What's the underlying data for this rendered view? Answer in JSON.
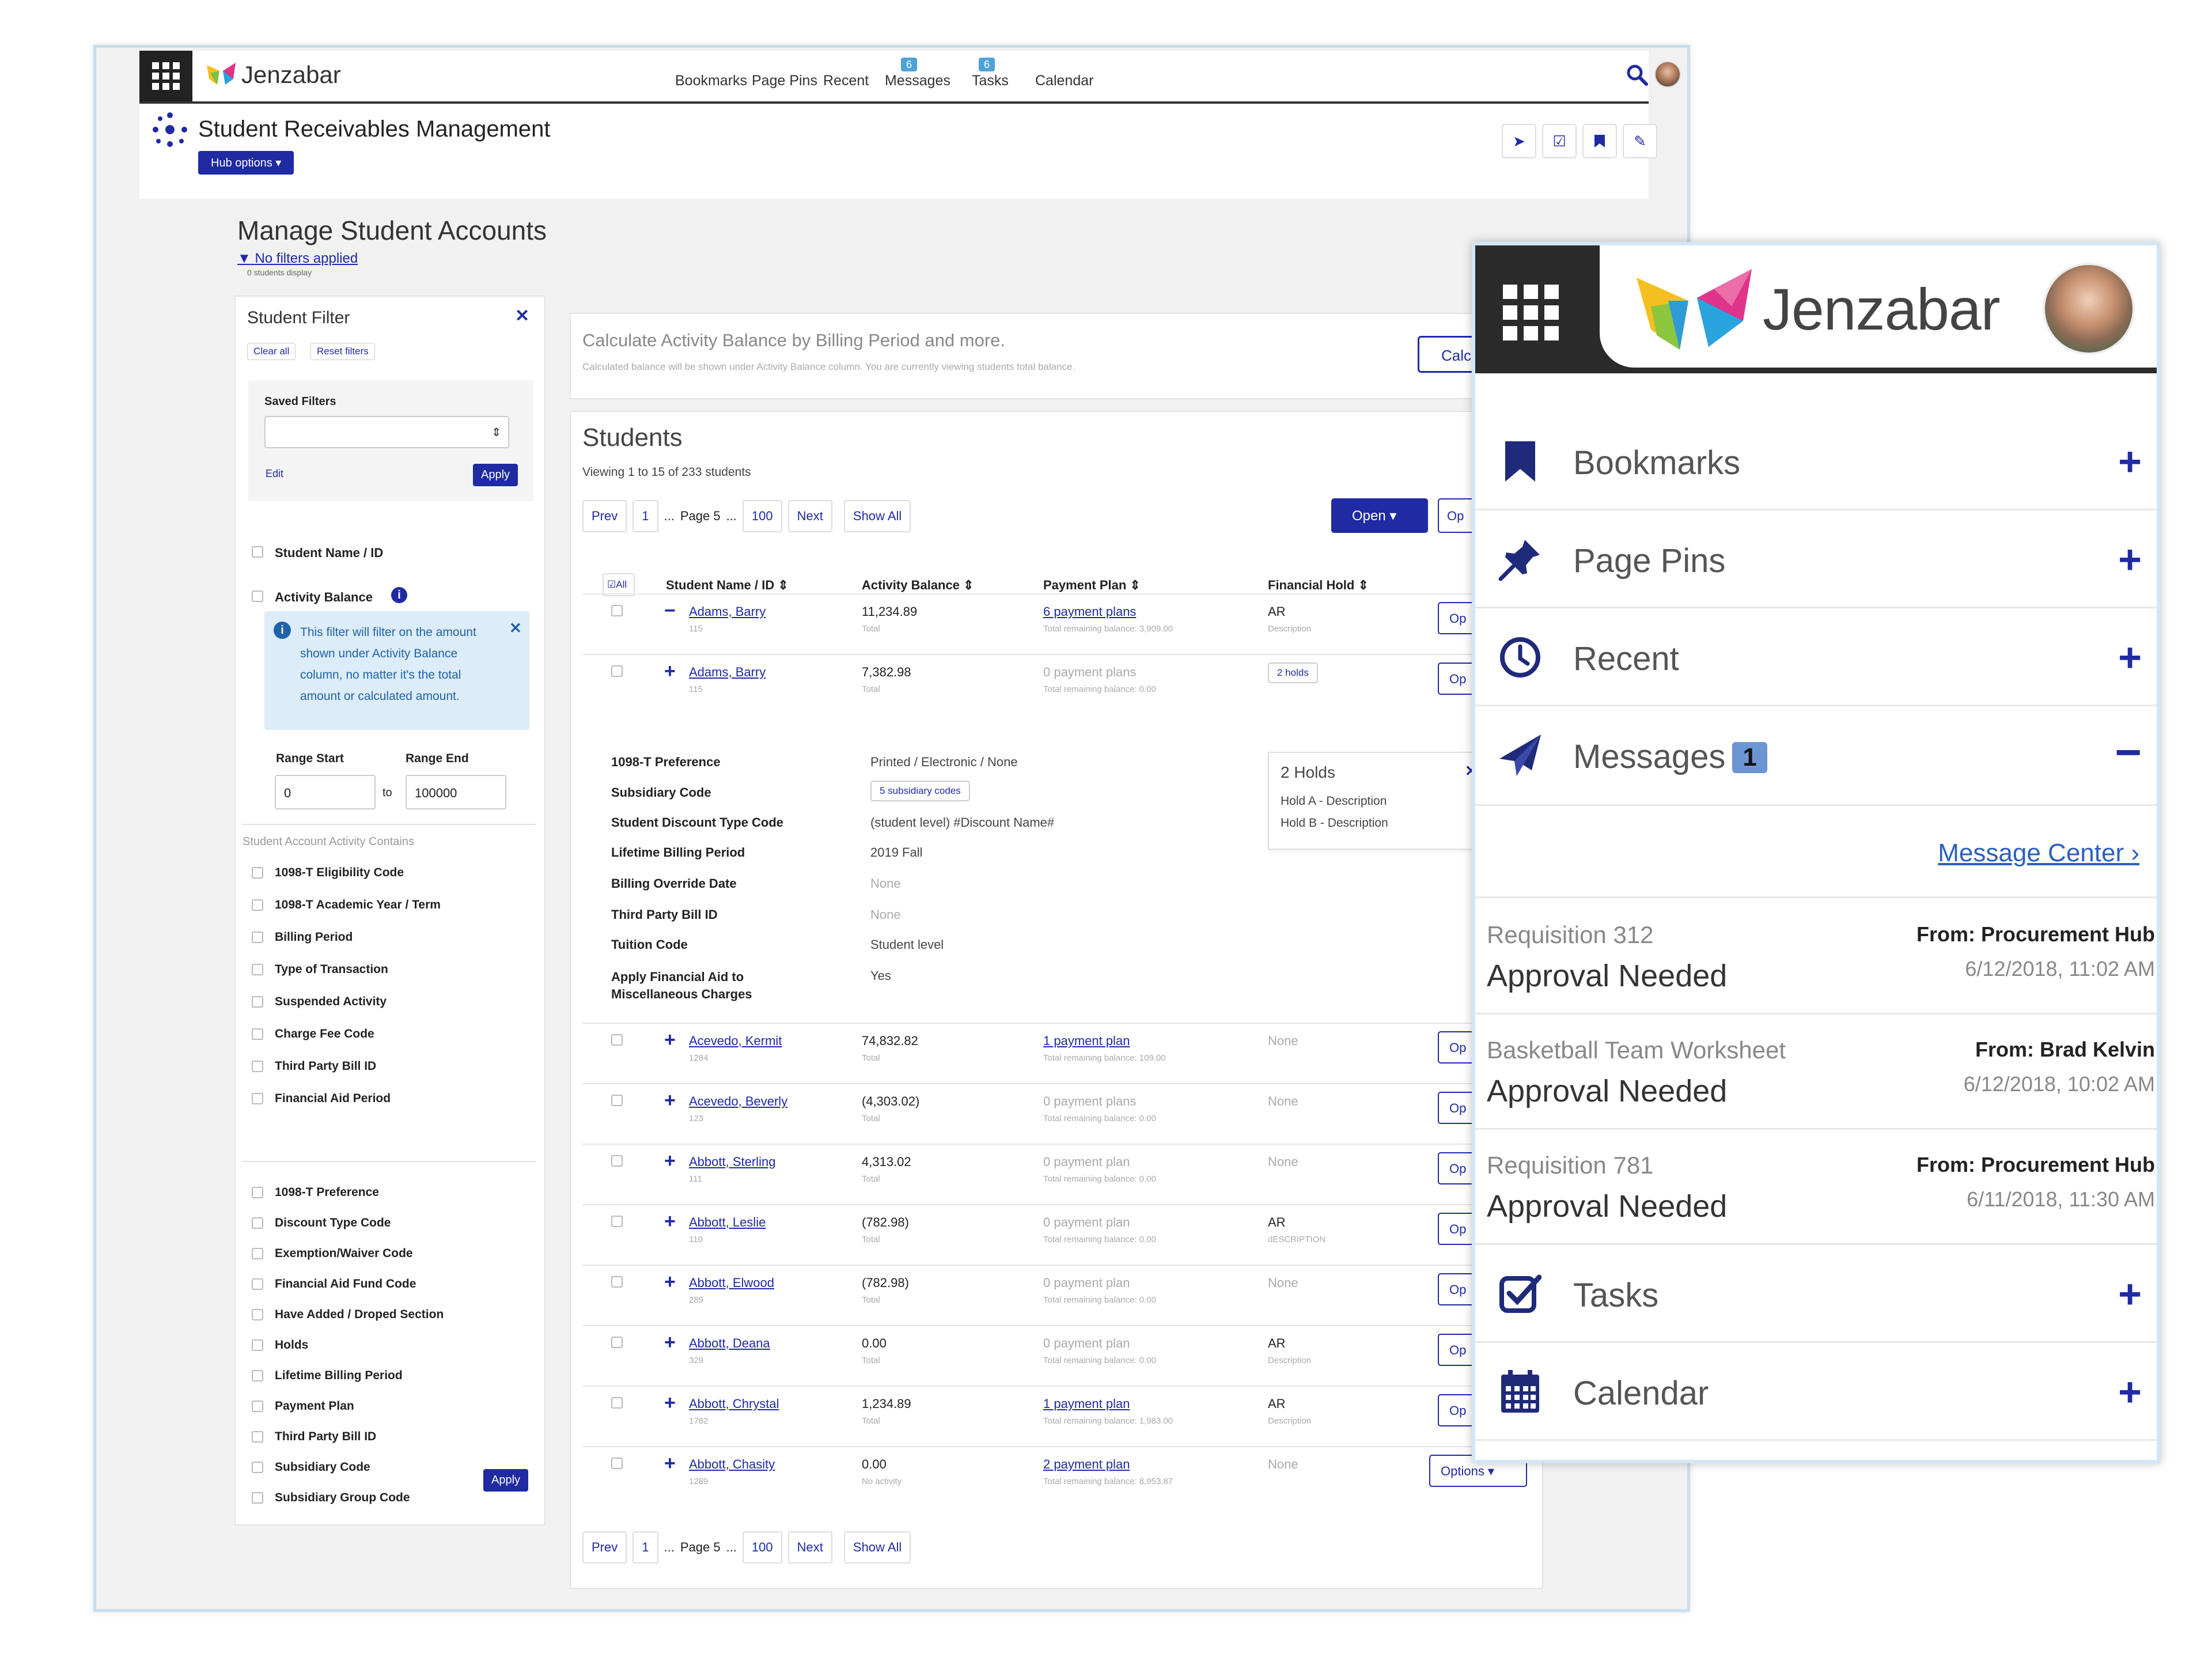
{
  "topbar": {
    "logo": "Jenzabar",
    "nav": [
      {
        "label": "Bookmarks",
        "badge": ""
      },
      {
        "label": "Page Pins",
        "badge": ""
      },
      {
        "label": "Recent",
        "badge": ""
      },
      {
        "label": "Messages",
        "badge": "6"
      },
      {
        "label": "Tasks",
        "badge": "6"
      },
      {
        "label": "Calendar",
        "badge": ""
      }
    ]
  },
  "hub": {
    "title": "Student Receivables Management",
    "options_label": "Hub options ▾"
  },
  "page": {
    "title": "Manage Student Accounts",
    "filters_link": "No filters applied",
    "count_text": "0 students display"
  },
  "filter": {
    "title": "Student Filter",
    "clear_all": "Clear all",
    "reset": "Reset filters",
    "saved_label": "Saved Filters",
    "edit": "Edit",
    "apply": "Apply",
    "name_id": "Student Name / ID",
    "activity_balance": "Activity Balance",
    "info": "This filter will filter on the amount shown under Activity Balance column, no matter it's the total amount or calculated amount.",
    "range_start_label": "Range Start",
    "range_end_label": "Range End",
    "range_start": "0",
    "range_to": "to",
    "range_end": "100000",
    "activity_header": "Student Account Activity Contains",
    "group1": [
      "1098-T Eligibility Code",
      "1098-T Academic Year / Term",
      "Billing Period",
      "Type of Transaction",
      "Suspended Activity",
      "Charge Fee Code",
      "Third Party Bill ID",
      "Financial Aid Period"
    ],
    "group2": [
      "1098-T Preference",
      "Discount Type Code",
      "Exemption/Waiver Code",
      "Financial Aid Fund Code",
      "Have Added / Droped Section",
      "Holds",
      "Lifetime Billing Period",
      "Payment Plan",
      "Third Party Bill ID",
      "Subsidiary Code",
      "Subsidiary Group Code"
    ],
    "apply_bottom": "Apply"
  },
  "calc": {
    "line1": "Calculate Activity Balance by Billing Period and more.",
    "line2": "Calculated balance will be shown under Activity Balance column. You are currently viewing students total balance.",
    "button": "Calc"
  },
  "students": {
    "title": "Students",
    "viewing": "Viewing 1 to 15 of 233 students",
    "pager": {
      "prev": "Prev",
      "first": "1",
      "dots": "...",
      "page": "Page 5",
      "dots2": "...",
      "last": "100",
      "next": "Next",
      "show_all": "Show All"
    },
    "open_btn": "Open",
    "op_btn": "Op",
    "headers": {
      "all": "All",
      "name": "Student Name / ID",
      "balance": "Activity Balance",
      "plan": "Payment Plan",
      "hold": "Financial Hold"
    },
    "rows": [
      {
        "name": "Adams, Barry",
        "id": "115",
        "balance": "11,234.89",
        "bal_sub": "Total",
        "plan": "6 payment plans",
        "plan_sub": "Total remaining balance: 3,909.00",
        "hold": "AR",
        "hold_sub": "Description",
        "opt": "Op",
        "expanded": "−"
      },
      {
        "name": "Adams, Barry",
        "id": "115",
        "balance": "7,382.98",
        "bal_sub": "Total",
        "plan": "0 payment plans",
        "plan_sub": "Total remaining balance: 0.00",
        "hold": "2 holds",
        "hold_sub": "",
        "opt": "Op",
        "expanded": "+"
      },
      {
        "name": "Acevedo, Kermit",
        "id": "1284",
        "balance": "74,832.82",
        "bal_sub": "Total",
        "plan": "1 payment plan",
        "plan_sub": "Total remaining balance: 109.00",
        "hold": "None",
        "hold_sub": "",
        "opt": "Op",
        "expanded": "+"
      },
      {
        "name": "Acevedo, Beverly",
        "id": "123",
        "balance": "(4,303.02)",
        "bal_sub": "Total",
        "plan": "0 payment plans",
        "plan_sub": "Total remaining balance: 0.00",
        "hold": "None",
        "hold_sub": "",
        "opt": "Op",
        "expanded": "+"
      },
      {
        "name": "Abbott, Sterling",
        "id": "111",
        "balance": "4,313.02",
        "bal_sub": "Total",
        "plan": "0 payment plan",
        "plan_sub": "Total remaining balance: 0.00",
        "hold": "None",
        "hold_sub": "",
        "opt": "Op",
        "expanded": "+"
      },
      {
        "name": "Abbott, Leslie",
        "id": "110",
        "balance": "(782.98)",
        "bal_sub": "Total",
        "plan": "0 payment plan",
        "plan_sub": "Total remaining balance: 0.00",
        "hold": "AR",
        "hold_sub": "dESCRIPTION",
        "opt": "Op",
        "expanded": "+"
      },
      {
        "name": "Abbott, Elwood",
        "id": "289",
        "balance": "(782.98)",
        "bal_sub": "Total",
        "plan": "0 payment plan",
        "plan_sub": "Total remaining balance: 0.00",
        "hold": "None",
        "hold_sub": "",
        "opt": "Op",
        "expanded": "+"
      },
      {
        "name": "Abbott, Deana",
        "id": "329",
        "balance": "0.00",
        "bal_sub": "Total",
        "plan": "0 payment plan",
        "plan_sub": "Total remaining balance: 0.00",
        "hold": "AR",
        "hold_sub": "Description",
        "opt": "Op",
        "expanded": "+"
      },
      {
        "name": "Abbott, Chrystal",
        "id": "1782",
        "balance": "1,234.89",
        "bal_sub": "Total",
        "plan": "1 payment plan",
        "plan_sub": "Total remaining balance: 1,983.00",
        "hold": "AR",
        "hold_sub": "Description",
        "opt": "Op",
        "expanded": "+"
      },
      {
        "name": "Abbott, Chasity",
        "id": "1289",
        "balance": "0.00",
        "bal_sub": "No activity",
        "plan": "2 payment plan",
        "plan_sub": "Total remaining balance: 8,953.87",
        "hold": "None",
        "hold_sub": "",
        "opt": "Options ▾",
        "expanded": "+"
      }
    ],
    "details": [
      {
        "label": "1098-T Preference",
        "value": "Printed / Electronic / None"
      },
      {
        "label": "Subsidiary Code",
        "value": "5 subsidiary codes"
      },
      {
        "label": "Student Discount Type Code",
        "value": "(student level) #Discount Name#"
      },
      {
        "label": "Lifetime Billing Period",
        "value": "2019 Fall"
      },
      {
        "label": "Billing Override Date",
        "value": "None"
      },
      {
        "label": "Third Party Bill ID",
        "value": "None"
      },
      {
        "label": "Tuition Code",
        "value": "Student level"
      },
      {
        "label": "Apply Financial Aid to Miscellaneous Charges",
        "value": "Yes"
      }
    ],
    "holds_popup": {
      "title": "2 Holds",
      "items": [
        "Hold A - Description",
        "Hold B - Description"
      ]
    }
  },
  "panel": {
    "logo": "Jenzabar",
    "items": [
      {
        "label": "Bookmarks",
        "icon": "bookmark-icon"
      },
      {
        "label": "Page Pins",
        "icon": "pin-icon"
      },
      {
        "label": "Recent",
        "icon": "clock-icon"
      },
      {
        "label": "Messages",
        "icon": "paper-plane-icon",
        "badge": "1"
      },
      {
        "label": "Tasks",
        "icon": "checkbox-icon"
      },
      {
        "label": "Calendar",
        "icon": "calendar-icon"
      }
    ],
    "message_center": "Message Center",
    "messages": [
      {
        "title": "Requisition 312",
        "subject": "Approval Needed",
        "from": "From: Procurement Hub",
        "date": "6/12/2018, 11:02 AM"
      },
      {
        "title": "Basketball Team Worksheet",
        "subject": "Approval Needed",
        "from": "From: Brad Kelvin",
        "date": "6/12/2018, 10:02 AM"
      },
      {
        "title": "Requisition 781",
        "subject": "Approval Needed",
        "from": "From: Procurement Hub",
        "date": "6/11/2018, 11:30 AM"
      }
    ],
    "accent": "#1f2aa3"
  }
}
